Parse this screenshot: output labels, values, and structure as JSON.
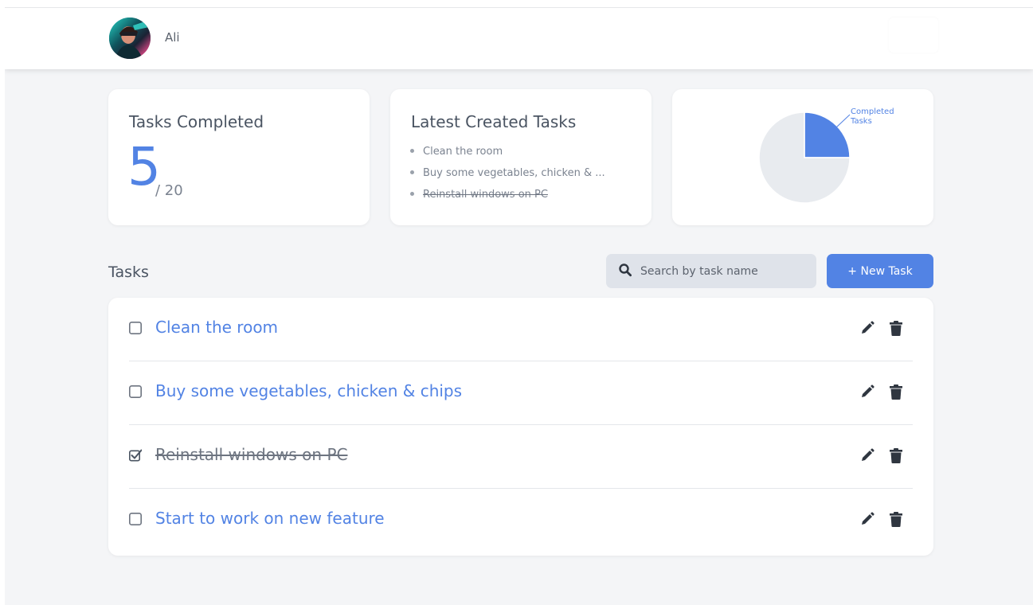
{
  "header": {
    "username": "Ali"
  },
  "stats": {
    "completed_title": "Tasks Completed",
    "completed_count": "5",
    "total_label": "/ 20",
    "latest_title": "Latest Created Tasks",
    "latest_tasks": [
      {
        "label": "Clean the room",
        "done": false
      },
      {
        "label": "Buy some vegetables, chicken & ...",
        "done": false
      },
      {
        "label": "Reinstall windows on PC",
        "done": true
      }
    ]
  },
  "chart_data": {
    "type": "pie",
    "slices": [
      {
        "name": "Completed Tasks",
        "value": 5,
        "color": "#5283e4"
      },
      {
        "name": "",
        "value": 15,
        "color": "#e8ebef"
      }
    ],
    "labels": [
      "Completed",
      "Tasks"
    ]
  },
  "tasks_section": {
    "title": "Tasks",
    "search_placeholder": "Search by task name",
    "new_task_label": "+ New Task"
  },
  "tasks": [
    {
      "label": "Clean the room",
      "done": false
    },
    {
      "label": "Buy some vegetables, chicken & chips",
      "done": false
    },
    {
      "label": "Reinstall windows on PC",
      "done": true
    },
    {
      "label": "Start to work on new feature",
      "done": false
    }
  ],
  "colors": {
    "accent": "#5283e4",
    "text": "#4a5462",
    "muted": "#7b8390",
    "background": "#f4f5f7"
  }
}
